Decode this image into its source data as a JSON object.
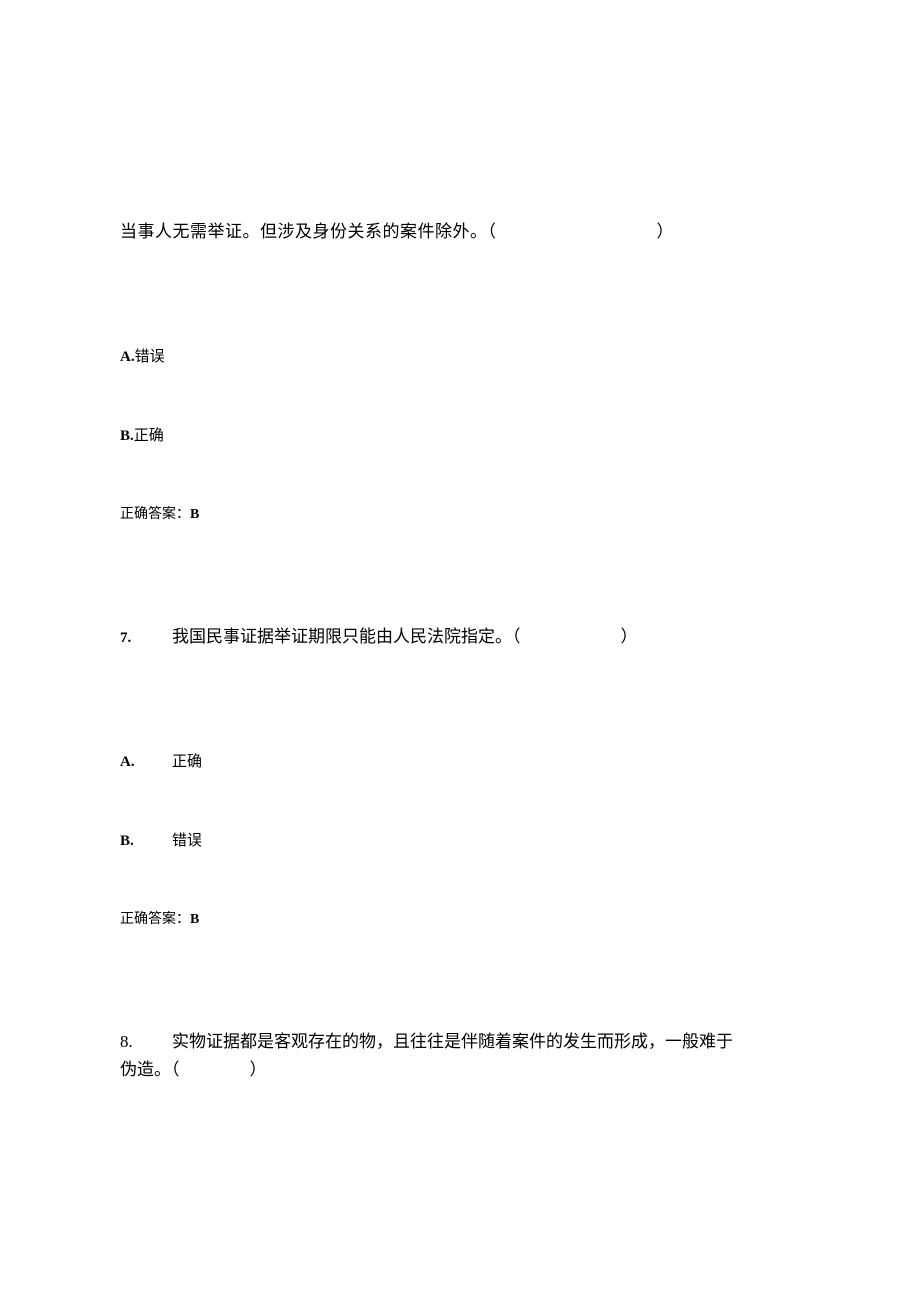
{
  "q6": {
    "continuation": "当事人无需举证。但涉及身份关系的案件除外。（",
    "continuation_end": "）",
    "optionA_label": "A.",
    "optionA_text": "错误",
    "optionB_label": "B.",
    "optionB_text": "正确",
    "answer_prefix": "正确答案：",
    "answer_value": "B"
  },
  "q7": {
    "number": "7.",
    "text": "我国民事证据举证期限只能由人民法院指定。（",
    "text_end": "）",
    "optionA_label": "A.",
    "optionA_text": "正确",
    "optionB_label": "B.",
    "optionB_text": "错误",
    "answer_prefix": "正确答案：",
    "answer_value": "B"
  },
  "q8": {
    "number": "8.",
    "text_line1": "实物证据都是客观存在的物，且往往是伴随着案件的发生而形成，一般难于",
    "text_line2": "伪造。（",
    "text_line2_end": "）"
  }
}
